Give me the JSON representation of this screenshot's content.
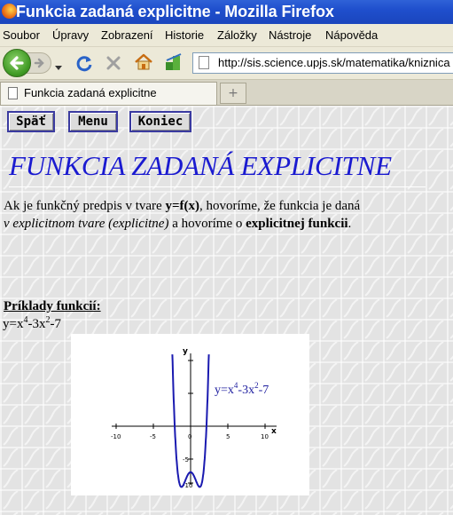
{
  "window": {
    "title": "Funkcia zadaná explicitne - Mozilla Firefox"
  },
  "menu": {
    "items": [
      "Soubor",
      "Úpravy",
      "Zobrazení",
      "Historie",
      "Záložky",
      "Nástroje",
      "Nápověda"
    ]
  },
  "nav": {
    "url": "http://sis.science.upjs.sk/matematika/kniznica",
    "icons": [
      "back-arrow",
      "forward-arrow",
      "history-dropdown",
      "reload",
      "stop",
      "home",
      "bookmarks-feed",
      "page"
    ]
  },
  "tabs": [
    {
      "label": "Funkcia zadaná explicitne"
    }
  ],
  "page": {
    "buttons": {
      "back": "Späť",
      "menu": "Menu",
      "end": "Koniec"
    },
    "heading": "FUNKCIA ZADANÁ EXPLICITNE",
    "intro": {
      "line1_a": "Ak je funkčný predpis v tvare ",
      "line1_bold": "y=f(x)",
      "line1_b": ", hovoríme, že funkcia je daná",
      "line2_italic": "v explicitnom tvare (explicitne)",
      "line2_a": " a hovoríme o ",
      "line2_bold": "explicitnej funkcii",
      "line2_end": "."
    },
    "examples_title": "Príklady funkcií:",
    "formula": {
      "y": "y=x",
      "exp1": "4",
      "mid": "-3x",
      "exp2": "2",
      "tail": "-7"
    }
  },
  "graph": {
    "label": {
      "y": "y=x",
      "exp1": "4",
      "mid": "-3x",
      "exp2": "2",
      "tail": "-7"
    },
    "x_axis_name": "x",
    "y_axis_name": "y",
    "x_ticks": [
      "-10",
      "-5",
      "0",
      "5",
      "10"
    ],
    "y_tick_labels": [
      "-5",
      "-10"
    ],
    "curve_color": "#1a1ab0",
    "label_color": "#2020a0"
  },
  "colors": {
    "titlebar": "#1f4fcd",
    "heading": "#1a1ad0",
    "button_border": "#3a3aa0"
  }
}
